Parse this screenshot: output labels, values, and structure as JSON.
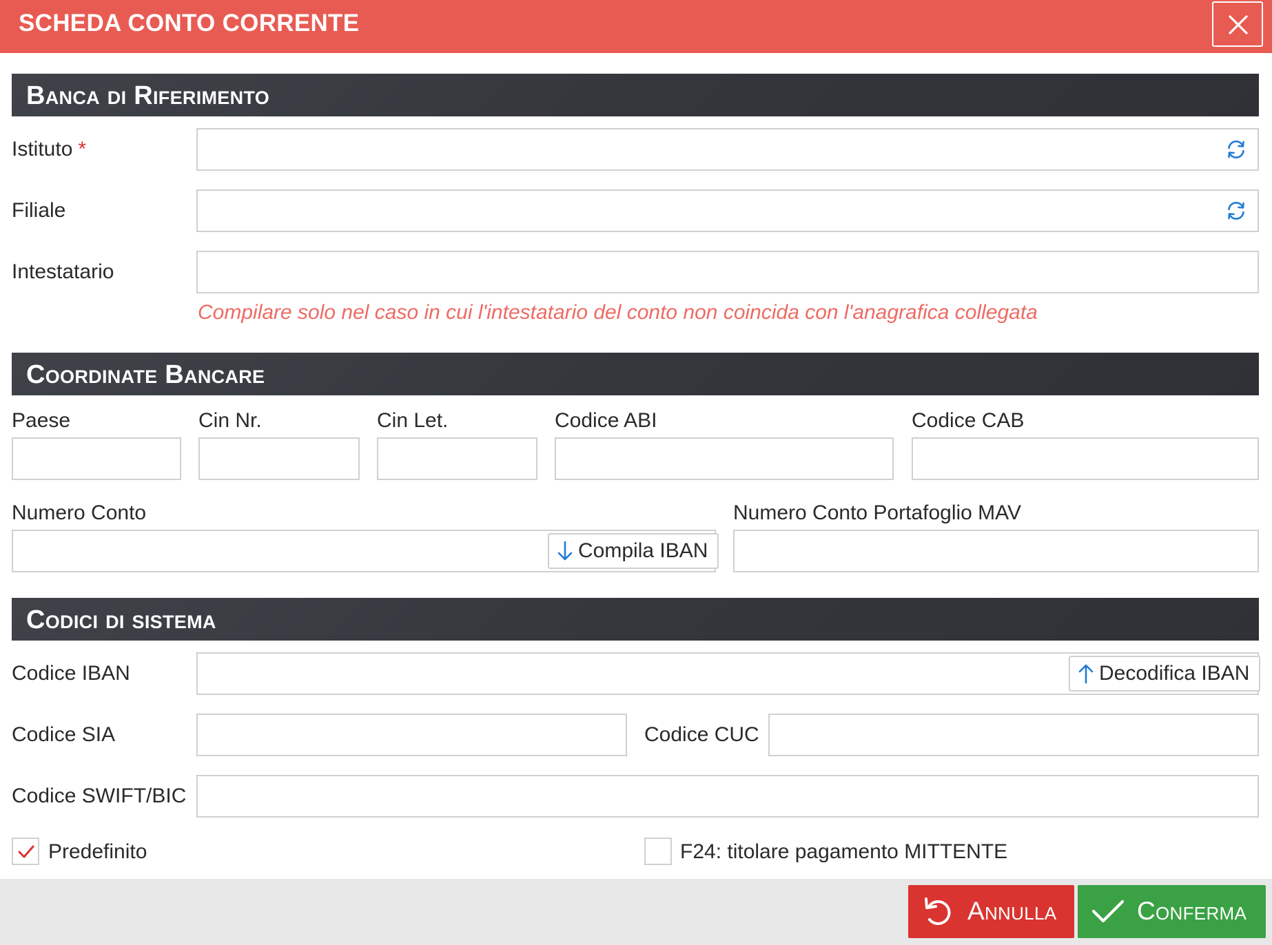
{
  "dialog": {
    "title": "SCHEDA CONTO CORRENTE"
  },
  "sections": {
    "bank": "Banca di Riferimento",
    "coords": "Coordinate Bancare",
    "codes": "Codici di sistema"
  },
  "bank": {
    "istituto_label": "Istituto",
    "required_mark": "*",
    "istituto_value": "",
    "filiale_label": "Filiale",
    "filiale_value": "",
    "intestatario_label": "Intestatario",
    "intestatario_value": "",
    "hint": "Compilare solo nel caso in cui l'intestatario del conto non coincida con l'anagrafica collegata"
  },
  "coords": {
    "paese_label": "Paese",
    "cin_nr_label": "Cin Nr.",
    "cin_let_label": "Cin Let.",
    "abi_label": "Codice ABI",
    "cab_label": "Codice CAB",
    "numero_conto_label": "Numero Conto",
    "compila_iban_label": "Compila IBAN",
    "mav_label": "Numero Conto Portafoglio MAV"
  },
  "codes": {
    "iban_label": "Codice IBAN",
    "decodifica_label": "Decodifica IBAN",
    "sia_label": "Codice SIA",
    "cuc_label": "Codice CUC",
    "swift_label": "Codice SWIFT/BIC"
  },
  "options": {
    "predefinito_label": "Predefinito",
    "predefinito_checked": true,
    "f24_label": "F24: titolare pagamento MITTENTE",
    "f24_checked": false
  },
  "footer": {
    "cancel_label": "Annulla",
    "confirm_label": "Conferma"
  },
  "colors": {
    "header": "#e85b52",
    "section": "#36383e",
    "accent_blue": "#1f7bd6",
    "hint": "#ec6b64",
    "cancel": "#d9342f",
    "confirm": "#3aa245"
  },
  "icons": {
    "close": "close-icon",
    "refresh": "refresh-icon",
    "arrow_down": "arrow-down-icon",
    "arrow_up": "arrow-up-icon",
    "check": "check-icon",
    "undo": "undo-icon"
  }
}
